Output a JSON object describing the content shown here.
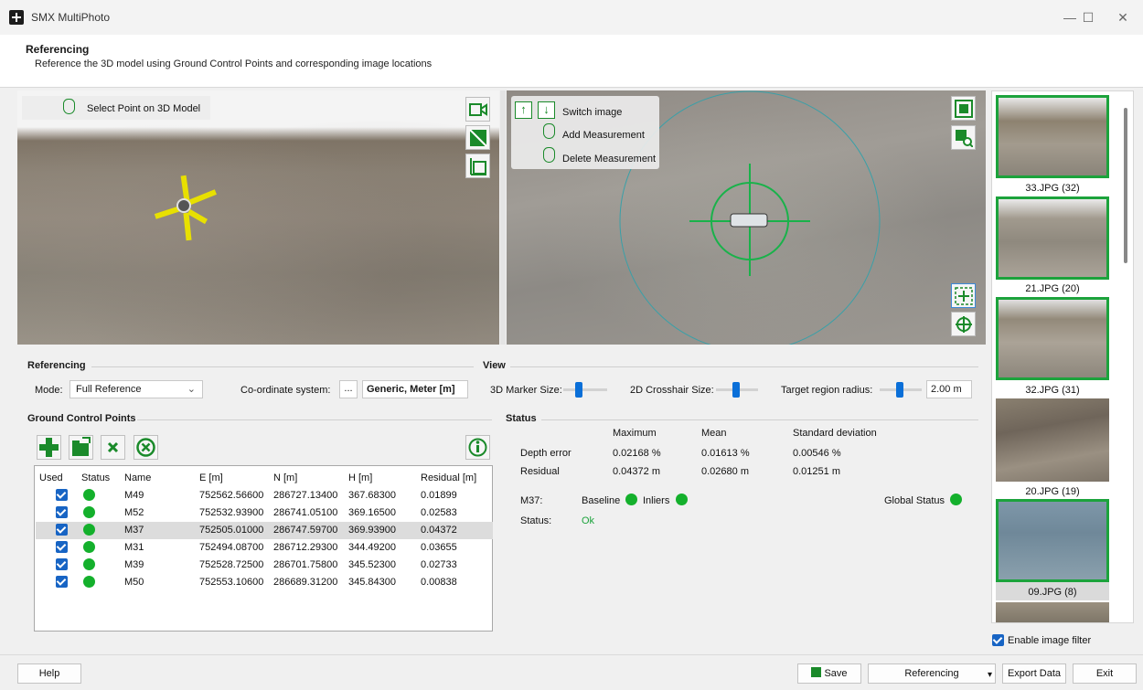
{
  "window": {
    "title": "SMX MultiPhoto",
    "minimize": "—",
    "maximize": "☐",
    "close": "✕"
  },
  "header": {
    "title": "Referencing",
    "subtitle": "Reference the 3D model using Ground Control Points and corresponding image locations"
  },
  "view3d": {
    "hint": "Select Point on 3D Model"
  },
  "view2d": {
    "switch_image": "Switch image",
    "add_measurement": "Add Measurement",
    "delete_measurement": "Delete Measurement"
  },
  "thumbnails": [
    {
      "label": "33.JPG (32)",
      "active": true
    },
    {
      "label": "21.JPG (20)",
      "active": true
    },
    {
      "label": "32.JPG (31)",
      "active": true
    },
    {
      "label": "20.JPG (19)",
      "active": false
    },
    {
      "label": "09.JPG (8)",
      "active": true
    }
  ],
  "enable_filter": {
    "label": "Enable image filter",
    "checked": true
  },
  "referencing": {
    "title": "Referencing",
    "mode_label": "Mode:",
    "mode_value": "Full Reference",
    "coord_label": "Co-ordinate system:",
    "coord_button": "...",
    "coord_value": "Generic, Meter [m]"
  },
  "view": {
    "title": "View",
    "marker_size_label": "3D Marker Size:",
    "crosshair_size_label": "2D Crosshair Size:",
    "target_radius_label": "Target region radius:",
    "target_radius_value": "2.00 m"
  },
  "gcp": {
    "title": "Ground Control Points",
    "columns": [
      "Used",
      "Status",
      "Name",
      "E [m]",
      "N [m]",
      "H [m]",
      "Residual [m]"
    ],
    "rows": [
      {
        "name": "M49",
        "e": "752562.56600",
        "n": "286727.13400",
        "h": "367.68300",
        "residual": "0.01899"
      },
      {
        "name": "M52",
        "e": "752532.93900",
        "n": "286741.05100",
        "h": "369.16500",
        "residual": "0.02583"
      },
      {
        "name": "M37",
        "e": "752505.01000",
        "n": "286747.59700",
        "h": "369.93900",
        "residual": "0.04372"
      },
      {
        "name": "M31",
        "e": "752494.08700",
        "n": "286712.29300",
        "h": "344.49200",
        "residual": "0.03655"
      },
      {
        "name": "M39",
        "e": "752528.72500",
        "n": "286701.75800",
        "h": "345.52300",
        "residual": "0.02733"
      },
      {
        "name": "M50",
        "e": "752553.10600",
        "n": "286689.31200",
        "h": "345.84300",
        "residual": "0.00838"
      }
    ]
  },
  "status": {
    "title": "Status",
    "headers": {
      "max": "Maximum",
      "mean": "Mean",
      "std": "Standard deviation"
    },
    "depth": {
      "label": "Depth error",
      "max": "0.02168 %",
      "mean": "0.01613 %",
      "std": "0.00546 %"
    },
    "residual": {
      "label": "Residual",
      "max": "0.04372 m",
      "mean": "0.02680 m",
      "std": "0.01251 m"
    },
    "point_label": "M37:",
    "baseline": "Baseline",
    "inliers": "Inliers",
    "global_status": "Global Status",
    "status_label": "Status:",
    "status_value": "Ok"
  },
  "buttons": {
    "help": "Help",
    "save": "Save",
    "referencing": "Referencing",
    "export": "Export Data",
    "exit": "Exit"
  },
  "colors": {
    "accent_green": "#1ca33c",
    "status_ok": "#14b02c",
    "slider_blue": "#0a6fd8"
  }
}
